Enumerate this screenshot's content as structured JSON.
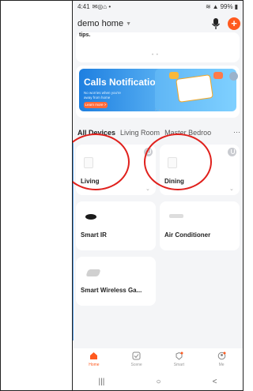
{
  "status_bar": {
    "time": "4:41",
    "left_icons": "✉◎⌂ •",
    "right_text": "99%"
  },
  "header": {
    "home_name": "demo home"
  },
  "top_card": {
    "partial_text": "tips."
  },
  "banner": {
    "title": "Calls Notification",
    "subtitle": "No worries when you're away from home",
    "button": "Learn more >"
  },
  "tabs": {
    "items": [
      "All Devices",
      "Living Room",
      "Master Bedroo"
    ],
    "more": "···"
  },
  "devices": [
    {
      "name": "Living"
    },
    {
      "name": "Dining"
    },
    {
      "name": "Smart IR"
    },
    {
      "name": "Air Conditioner"
    },
    {
      "name": "Smart Wireless Ga..."
    }
  ],
  "bottom_nav": [
    {
      "label": "Home",
      "icon": "home-icon"
    },
    {
      "label": "Scene",
      "icon": "scene-icon"
    },
    {
      "label": "Smart",
      "icon": "smart-icon"
    },
    {
      "label": "Me",
      "icon": "me-icon"
    }
  ],
  "system_keys": {
    "recents": "|||",
    "home": "○",
    "back": "<"
  },
  "colors": {
    "accent": "#ff5a1f",
    "highlight_circle": "#e0201c",
    "banner_blue": "#1e7fe0"
  }
}
